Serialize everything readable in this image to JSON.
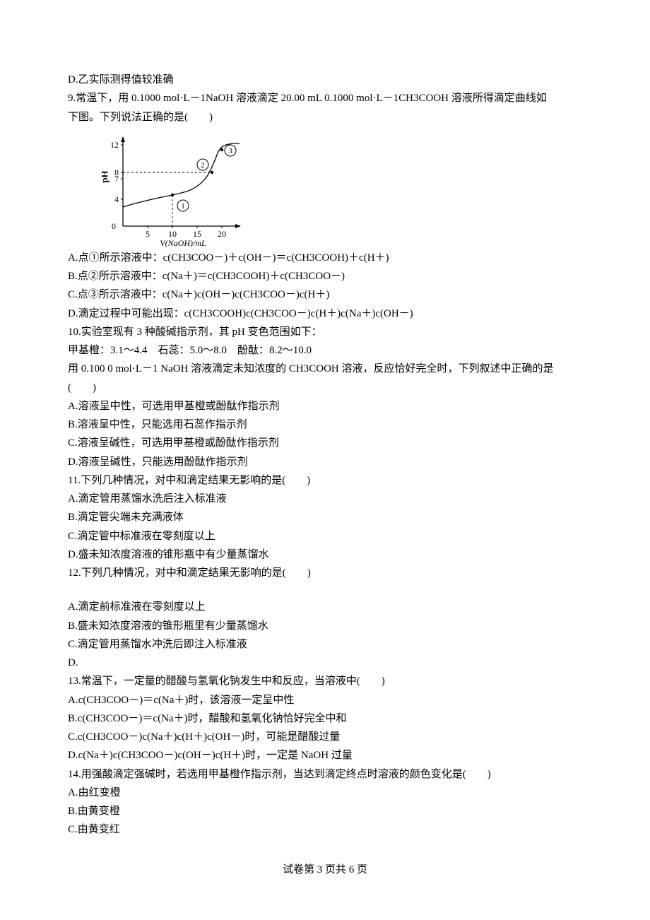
{
  "q8": {
    "D": "D.乙实际测得值较准确"
  },
  "q9": {
    "stem1": "9.常温下，用 0.1000 mol·L－1NaOH 溶液滴定 20.00 mL 0.1000 mol·L－1CH3COOH 溶液所得滴定曲线如",
    "stem2": "下图。下列说法正确的是(　　)",
    "A": "A.点①所示溶液中：c(CH3COO－)＋c(OH－)＝c(CH3COOH)＋c(H＋)",
    "B": "B.点②所示溶液中：c(Na＋)＝c(CH3COOH)＋c(CH3COO－)",
    "C": "C.点③所示溶液中：c(Na＋)c(OH－)c(CH3COO－)c(H＋)",
    "D": "D.滴定过程中可能出现：c(CH3COOH)c(CH3COO－)c(H＋)c(Na＋)c(OH－)"
  },
  "q10": {
    "stem1": "10.实验室现有 3 种酸碱指示剂，其 pH 变色范围如下：",
    "stem2": "甲基橙：3.1～4.4　石蕊：5.0～8.0　酚酞：8.2～10.0",
    "stem3": "用 0.100 0 mol·L－1 NaOH 溶液滴定未知浓度的 CH3COOH 溶液，反应恰好完全时，下列叙述中正确的是",
    "stem4": "(　　)",
    "A": "A.溶液呈中性，可选用甲基橙或酚酞作指示剂",
    "B": "B.溶液呈中性，只能选用石蕊作指示剂",
    "C": "C.溶液呈碱性，可选用甲基橙或酚酞作指示剂",
    "D": "D.溶液呈碱性，只能选用酚酞作指示剂"
  },
  "q11": {
    "stem": "11.下列几种情况，对中和滴定结果无影响的是(　　)",
    "A": "A.滴定管用蒸馏水洗后注入标准液",
    "B": "B.滴定管尖端未充满液体",
    "C": "C.滴定管中标准液在零刻度以上",
    "D": "D.盛未知浓度溶液的锥形瓶中有少量蒸馏水"
  },
  "q12": {
    "stem": "12.下列几种情况，对中和滴定结果无影响的是(　　)",
    "A": "A.滴定前标准液在零刻度以上",
    "B": "B.盛未知浓度溶液的锥形瓶里有少量蒸馏水",
    "C": "C.滴定管用蒸馏水冲洗后即注入标准液",
    "D": "D."
  },
  "q13": {
    "stem": "13.常温下，一定量的醋酸与氢氧化钠发生中和反应，当溶液中(　　)",
    "A": "A.c(CH3COO－)＝c(Na＋)时，该溶液一定呈中性",
    "B": "B.c(CH3COO－)＝c(Na＋)时，醋酸和氢氧化钠恰好完全中和",
    "C": "C.c(CH3COO－)c(Na＋)c(H＋)c(OH－)时，可能是醋酸过量",
    "D": "D.c(Na＋)c(CH3COO－)c(OH－)c(H＋)时，一定是 NaOH 过量"
  },
  "q14": {
    "stem": "14.用强酸滴定强碱时，若选用甲基橙作指示剂，当达到滴定终点时溶液的颜色变化是(　　)",
    "A": "A.由红变橙",
    "B": "B.由黄变橙",
    "C": "C.由黄变红"
  },
  "footer": "试卷第 3 页共 6 页",
  "chart_data": {
    "type": "line",
    "xlabel": "V(NaOH)/mL",
    "ylabel": "pH",
    "title": "",
    "xlim": [
      0,
      22
    ],
    "ylim": [
      0,
      13
    ],
    "xticks": [
      0,
      5,
      10,
      15,
      20
    ],
    "yticks": [
      0,
      4,
      7,
      8,
      12
    ],
    "series": [
      {
        "name": "curve",
        "x": [
          0,
          2,
          5,
          8,
          10,
          12,
          15,
          17,
          18,
          19,
          19.5,
          20,
          20.3,
          20.6,
          21,
          22
        ],
        "y": [
          2.9,
          3.4,
          3.9,
          4.3,
          4.6,
          5.0,
          5.8,
          6.6,
          7.3,
          8.3,
          9.7,
          11.3,
          11.8,
          12.0,
          12.1,
          12.2
        ]
      }
    ],
    "annotations": [
      {
        "label": "①",
        "x": 10,
        "y": 4.6
      },
      {
        "label": "②",
        "x": 15,
        "y": 8
      },
      {
        "label": "③",
        "x": 20,
        "y": 11.3
      }
    ],
    "guides": [
      {
        "axis": "y",
        "value": 8,
        "to_x": 18
      },
      {
        "axis": "x",
        "value": 10,
        "to_y": 4.6
      }
    ]
  }
}
